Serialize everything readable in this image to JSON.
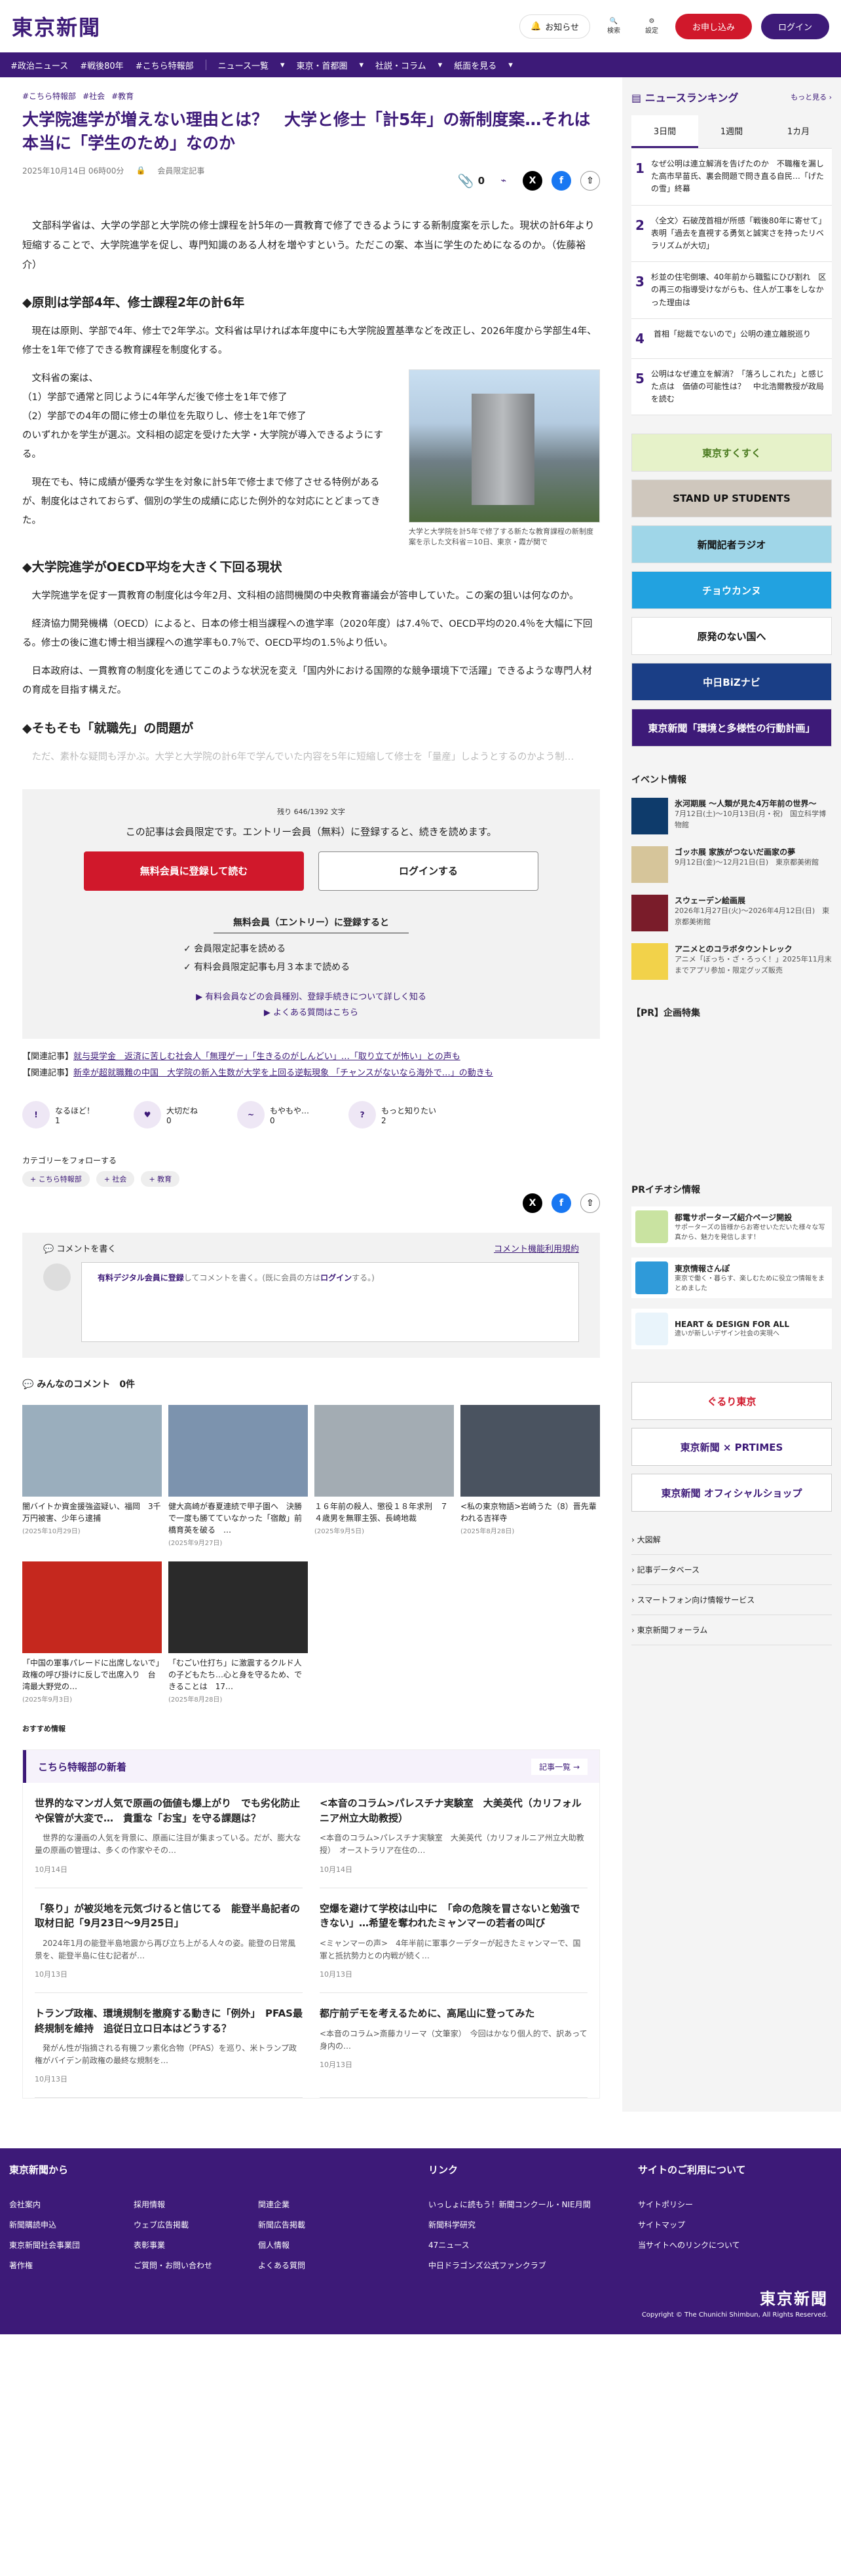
{
  "header": {
    "logo": "東京新聞",
    "notice": "お知らせ",
    "search": "検索",
    "settings": "設定",
    "signup": "お申し込み",
    "login": "ログイン"
  },
  "nav": [
    "#政治ニュース",
    "#戦後80年",
    "#こちら特報部",
    "ニュース一覧",
    "東京・首都圏",
    "社説・コラム",
    "紙面を見る"
  ],
  "article": {
    "tags": [
      "#こちら特報部",
      "#社会",
      "#教育"
    ],
    "title": "大学院進学が増えない理由とは？　大学と修士「計5年」の新制度案…それは本当に「学生のため」なのか",
    "date": "2025年10月14日 06時00分",
    "limited": "会員限定記事",
    "clip_count": "0",
    "lead": "　文部科学省は、大学の学部と大学院の修士課程を計5年の一貫教育で修了できるようにする新制度案を示した。現状の計6年より短縮することで、大学院進学を促し、専門知識のある人材を増やすという。ただこの案、本当に学生のためになるのか。（佐藤裕介）",
    "h1": "◆原則は学部4年、修士課程2年の計6年",
    "p1": "　現在は原則、学部で4年、修士で2年学ぶ。文科省は早ければ本年度中にも大学院設置基準などを改正し、2026年度から学部生4年、修士を1年で修了できる教育課程を制度化する。",
    "p2a": "　文科省の案は、",
    "p2b": "（1）学部で通常と同じように4年学んだ後で修士を1年で修了",
    "p2c": "（2）学部での4年の間に修士の単位を先取りし、修士を1年で修了",
    "p2d": "のいずれかを学生が選ぶ。文科相の認定を受けた大学・大学院が導入できるようにする。",
    "p3": "　現在でも、特に成績が優秀な学生を対象に計5年で修士まで修了させる特例があるが、制度化はされておらず、個別の学生の成績に応じた例外的な対応にとどまってきた。",
    "caption": "大学と大学院を計5年で修了する新たな教育課程の新制度案を示した文科省＝10日、東京・霞が関で",
    "h2": "◆大学院進学がOECD平均を大きく下回る現状",
    "p4": "　大学院進学を促す一貫教育の制度化は今年2月、文科相の諮問機関の中央教育審議会が答申していた。この案の狙いは何なのか。",
    "p5": "　経済協力開発機構（OECD）によると、日本の修士相当課程への進学率（2020年度）は7.4％で、OECD平均の20.4％を大幅に下回る。修士の後に進む博士相当課程への進学率も0.7％で、OECD平均の1.5％より低い。",
    "p6": "　日本政府は、一貫教育の制度化を通じてこのような状況を変え「国内外における国際的な競争環境下で活躍」できるような専門人材の育成を目指す構えだ。",
    "h3": "◆そもそも「就職先」の問題が",
    "p7": "　ただ、素朴な疑問も浮かぶ。大学と大学院の計6年で学んでいた内容を5年に短縮して修士を「量産」しようとするのかよう制…"
  },
  "paywall": {
    "remaining": "残り 646/1392 文字",
    "message": "この記事は会員限定です。エントリー会員（無料）に登録すると、続きを読めます。",
    "free_btn": "無料会員に登録して読む",
    "login_btn": "ログインする",
    "entry_title": "無料会員（エントリー）に登録すると",
    "benefits": [
      "✓ 会員限定記事を読める",
      "✓ 有料会員限定記事も月３本まで読める"
    ],
    "link1": "▶ 有料会員などの会員種別、登録手続きについて詳しく知る",
    "link2": "▶ よくある質問はこちら"
  },
  "related": [
    {
      "label": "【関連記事】",
      "text": "就与奨学金　返済に苦しむ社会人「無理ゲー」「生きるのがしんどい」…「取り立てが怖い」との声も"
    },
    {
      "label": "【関連記事】",
      "text": "新幸が超就職難の中国　大学院の新入生数が大学を上回る逆転現象 「チャンスがないなら海外で…」の動きも"
    }
  ],
  "reactions": [
    {
      "icon": "!",
      "label": "なるほど！",
      "count": "1"
    },
    {
      "icon": "♥",
      "label": "大切だね",
      "count": "0"
    },
    {
      "icon": "~",
      "label": "もやもや…",
      "count": "0"
    },
    {
      "icon": "?",
      "label": "もっと知りたい",
      "count": "2"
    }
  ],
  "follow": {
    "title": "カテゴリーをフォローする",
    "chips": [
      "+ こちら特報部",
      "+ 社会",
      "+ 教育"
    ]
  },
  "comment": {
    "title": "コメントを書く",
    "policy": "コメント機能利用規約",
    "prompt_link": "有料デジタル会員に登録",
    "prompt_text": "してコメントを書く。(既に会員の方は",
    "prompt_login": "ログイン",
    "prompt_end": "する。)"
  },
  "everyone": {
    "title": "みんなのコメント",
    "count": "0件"
  },
  "cards": [
    {
      "t": "闇バイトか資金援強盗疑い、福岡　3千万円被害、少年ら逮捕",
      "d": "(2025年10月29日)",
      "c": "#9aaebd"
    },
    {
      "t": "健大高崎が春夏連続で甲子園へ　決勝で一度も勝てていなかった「宿敵」前橋育英を破る　…",
      "d": "(2025年9月27日)",
      "c": "#7c93ae"
    },
    {
      "t": "１６年前の殺人、懲役１８年求刑　７４歳男を無罪主張、長崎地裁",
      "d": "(2025年9月5日)",
      "c": "#a3acb3"
    },
    {
      "t": "<私の東京物語>岩崎うた（8）晋先輩われる吉祥寺",
      "d": "(2025年8月28日)",
      "c": "#4a5360"
    },
    {
      "t": "「中国の軍事パレードに出席しないで」政権の呼び掛けに反しで出席入り　台湾最大野党の…",
      "d": "(2025年9月3日)",
      "c": "#c5281e"
    },
    {
      "t": "「むごい仕打ち」に激震するクルド人の子どもたち…心と身を守るため、できることは　17…",
      "d": "(2025年8月28日)",
      "c": "#2a2a2a"
    }
  ],
  "recommend": "おすすめ情報",
  "newsSection": {
    "title": "こちら特報部の新着",
    "more": "記事一覧 →",
    "items": [
      {
        "t": "世界的なマンガ人気で原画の価値も爆上がり　でも劣化防止や保管が大変で…　貴重な「お宝」を守る課題は？",
        "s": "　世界的な漫画の人気を背景に、原画に注目が集まっている。だが、膨大な量の原画の管理は、多くの作家やその…",
        "d": "10月14日"
      },
      {
        "t": "<本音のコラム>パレスチナ実験室　大美英代（カリフォルニア州立大助教授）",
        "s": "<本音のコラム>パレスチナ実験室　大美英代（カリフォルニア州立大助教授）　オーストラリア在住の…",
        "d": "10月14日"
      },
      {
        "t": "「祭り」が被災地を元気づけると信じてる　能登半島記者の取材日記「9月23日〜9月25日」",
        "s": "　2024年1月の能登半島地震から再び立ち上がる人々の姿。能登の日常風景を、能登半島に住む記者が…",
        "d": "10月13日"
      },
      {
        "t": "空爆を避けて学校は山中に　「命の危険を冒さないと勉強できない」…希望を奪われたミャンマーの若者の叫び",
        "s": "<ミャンマーの声>　4年半前に軍事クーデターが起きたミャンマーで、国軍と抵抗勢力との内戦が続く…",
        "d": "10月13日"
      },
      {
        "t": "トランプ政権、環境規制を撤廃する動きに「例外」　PFAS最終規制を維持　追従日立ロ日本はどうする？",
        "s": "　発がん性が指摘される有機フッ素化合物（PFAS）を巡り、米トランプ政権がバイデン前政権の最終な規制を…",
        "d": "10月13日"
      },
      {
        "t": "都庁前デモを考えるために、高尾山に登ってみた",
        "s": "<本音のコラム>斎藤カリーマ（文筆家）　今回はかなり個人的で、訳あって身内の…",
        "d": "10月13日"
      }
    ]
  },
  "ranking": {
    "title": "ニュースランキング",
    "more": "もっと見る ›",
    "tabs": [
      "3日間",
      "1週間",
      "1カ月"
    ],
    "items": [
      "なぜ公明は連立解消を告げたのか　不職権を漏した高市早苗氏、裏会問題で問き直る自民…「げたの雪」終幕",
      "〈全文〉石破茂首相が所感「戦後80年に寄せて」表明「過去を直視する勇気と誠実さを持ったリベラリズムが大切」",
      "杉並の住宅倒壊、40年前から職監にひび割れ　区の再三の指導受けながらも、住人が工事をしなかった理由は",
      "首相「総裁でないので」公明の連立離脱巡り",
      "公明はなぜ連立を解消？「落ろしこれた」と感じた点は　価値の可能性は？　中北浩爾教授が政局を読む"
    ]
  },
  "banners": [
    {
      "t": "東京すくすく",
      "bg": "#e6f2c9",
      "fg": "#4a7a1f"
    },
    {
      "t": "STAND UP STUDENTS",
      "bg": "#cfc7bd",
      "fg": "#111"
    },
    {
      "t": "新聞記者ラジオ",
      "bg": "#9fd6e8",
      "fg": "#111"
    },
    {
      "t": "チョウカンヌ",
      "bg": "#22a2e0",
      "fg": "#fff"
    },
    {
      "t": "原発のない国へ",
      "bg": "#ffffff",
      "fg": "#111"
    },
    {
      "t": "中日BiZナビ",
      "bg": "#1a3e86",
      "fg": "#fff"
    },
    {
      "t": "東京新聞「環境と多様性の行動計画」",
      "bg": "#3d1a78",
      "fg": "#fff"
    }
  ],
  "events": {
    "title": "イベント情報",
    "items": [
      {
        "t": "氷河期展 ～人類が見た4万年前の世界～",
        "s": "7月12日(土)～10月13日(月・祝)　国立科学博物館",
        "c": "#0e3b6b"
      },
      {
        "t": "ゴッホ展 家族がつないだ画家の夢",
        "s": "9月12日(金)～12月21日(日)　東京都美術館",
        "c": "#d6c59a"
      },
      {
        "t": "スウェーデン絵画展",
        "s": "2026年1月27日(火)～2026年4月12日(日)　東京都美術館",
        "c": "#7a1c2a"
      },
      {
        "t": "アニメとのコラボタウントレック",
        "s": "アニメ「ぼっち・ざ・ろっく！」2025年11月末までアプリ参加・限定グッズ販売",
        "c": "#f2d24a"
      }
    ]
  },
  "prPlan": "【PR】企画特集",
  "prInfo": {
    "title": "PRイチオシ情報",
    "items": [
      {
        "t": "都電サポーターズ紹介ページ開設",
        "s": "サポーターズの皆様からお寄せいただいた様々な写真から、魅力を発信します！",
        "c": "#c9e3a1"
      },
      {
        "t": "東京情報さんぽ",
        "s": "東京で働く・暮らす、楽しむために役立つ情報をまとめました",
        "c": "#2f9ad9"
      },
      {
        "t": "HEART & DESIGN FOR ALL",
        "s": "違いが新しいデザイン社会の実現へ",
        "c": "#e9f4fb"
      }
    ]
  },
  "bottomBanners": [
    {
      "t": "ぐるり東京",
      "bg": "#fff",
      "fg": "#d0182b"
    },
    {
      "t": "東京新聞 × PRTIMES",
      "bg": "#fff",
      "fg": "#3d1a78"
    },
    {
      "t": "東京新聞 オフィシャルショップ",
      "bg": "#fff",
      "fg": "#3d1a78"
    }
  ],
  "sideLinks": [
    "大図解",
    "記事データベース",
    "スマートフォン向け情報サービス",
    "東京新聞フォーラム"
  ],
  "footer": {
    "col1": "東京新聞から",
    "col1_items": [
      "会社案内",
      "採用情報",
      "関連企業",
      "新聞購読申込",
      "ウェブ広告掲載",
      "新聞広告掲載",
      "東京新聞社会事業団",
      "表彰事業",
      "個人情報",
      "著作権",
      "ご質問・お問い合わせ",
      "よくある質問"
    ],
    "col2": "リンク",
    "col2_items": [
      "いっしょに読もう！新聞コンクール・NIE月間",
      "新聞科学研究",
      "47ニュース",
      "中日ドラゴンズ公式ファンクラブ"
    ],
    "col3": "サイトのご利用について",
    "col3_items": [
      "サイトポリシー",
      "サイトマップ",
      "当サイトへのリンクについて"
    ],
    "logo": "東京新聞",
    "copyright": "Copyright © The Chunichi Shimbun, All Rights Reserved."
  }
}
